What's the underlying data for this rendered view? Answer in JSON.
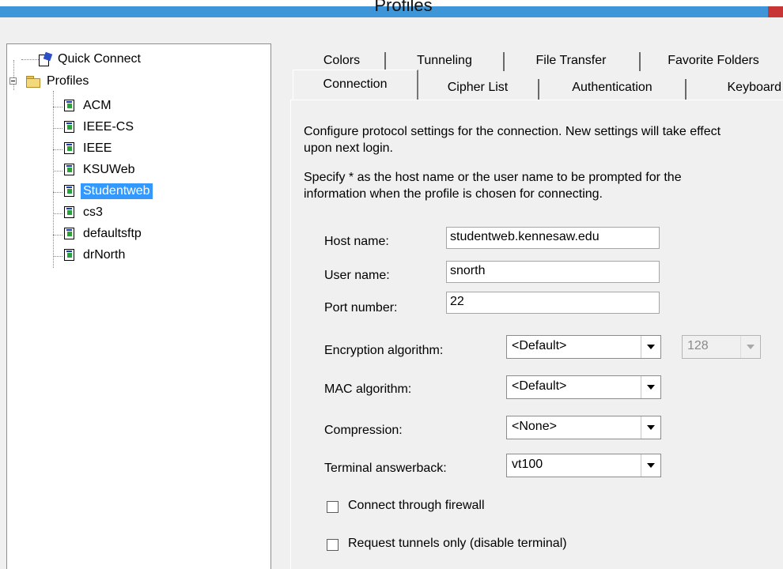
{
  "window": {
    "title": "Profiles"
  },
  "tree": {
    "quick_connect": "Quick Connect",
    "profiles_folder": "Profiles",
    "items": [
      "ACM",
      "IEEE-CS",
      "IEEE",
      "KSUWeb",
      "Studentweb",
      "cs3",
      "defaultsftp",
      "drNorth"
    ],
    "selected": "Studentweb"
  },
  "tabs": {
    "row_back": [
      "Colors",
      "Tunneling",
      "File Transfer",
      "Favorite Folders"
    ],
    "row_front": [
      "Connection",
      "Cipher List",
      "Authentication",
      "Keyboard"
    ],
    "active": "Connection"
  },
  "connection": {
    "intro": "Configure protocol settings for the connection. New settings will take effect upon next login.",
    "intro_line1": "Configure protocol settings for the connection. New settings will take effect",
    "intro_line2": "upon next login.",
    "hint_line1": "Specify * as the host name or the user name to be prompted for the",
    "hint_line2": "information when the profile is chosen for connecting.",
    "host_label": "Host name:",
    "host_value": "studentweb.kennesaw.edu",
    "user_label": "User name:",
    "user_value": "snorth",
    "port_label": "Port number:",
    "port_value": "22",
    "encryption_label": "Encryption algorithm:",
    "encryption_value": "<Default>",
    "key_size_value": "128",
    "mac_label": "MAC algorithm:",
    "mac_value": "<Default>",
    "compression_label": "Compression:",
    "compression_value": "<None>",
    "answerback_label": "Terminal answerback:",
    "answerback_value": "vt100",
    "firewall_label": "Connect through firewall",
    "firewall_checked": false,
    "tunnels_label": "Request tunnels only (disable terminal)",
    "tunnels_checked": false
  },
  "colors": {
    "selection": "#3399ff",
    "titlebar": "#3e95d8",
    "close": "#c73535"
  }
}
